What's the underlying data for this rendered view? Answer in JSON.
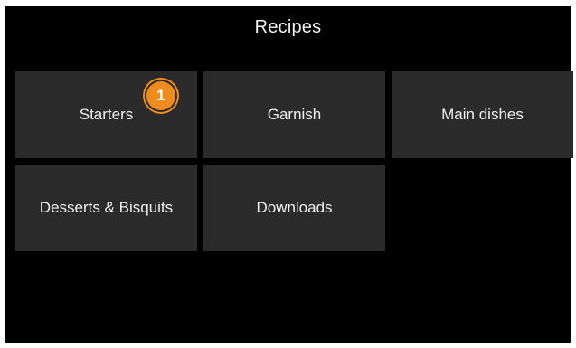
{
  "header": {
    "title": "Recipes"
  },
  "tiles": [
    {
      "label": "Starters"
    },
    {
      "label": "Garnish"
    },
    {
      "label": "Main dishes"
    },
    {
      "label": "Desserts & Bisquits"
    },
    {
      "label": "Downloads"
    }
  ],
  "callout": {
    "number": "1"
  },
  "colors": {
    "background": "#000000",
    "tile": "#2b2b2b",
    "callout": "#f08c1e",
    "text": "#f0f0f0"
  }
}
